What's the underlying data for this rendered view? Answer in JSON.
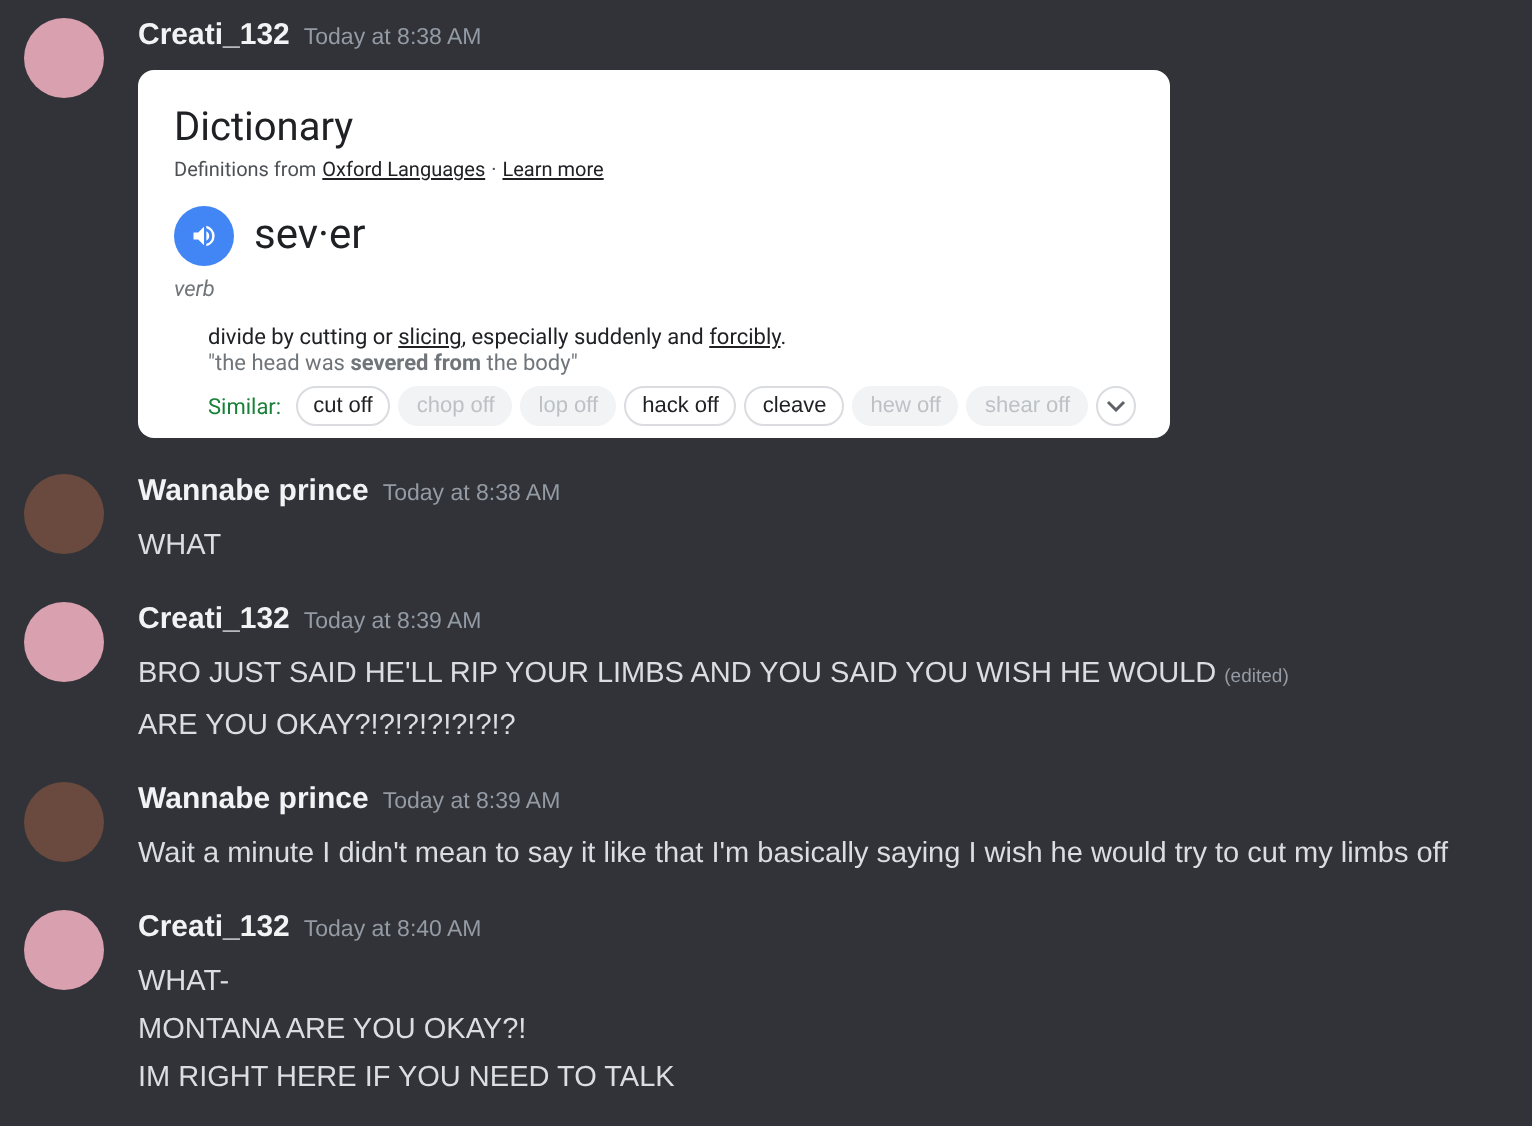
{
  "messages": [
    {
      "author": "Creati_132",
      "time": "Today at 8:38 AM",
      "color": "#d9a0b0",
      "embed": {
        "title": "Dictionary",
        "source_prefix": "Definitions from",
        "source_link": "Oxford Languages",
        "separator": "·",
        "learn_more": "Learn more",
        "word": "sev·er",
        "part_of_speech": "verb",
        "definition": [
          {
            "text": "divide by cutting or ",
            "link": false
          },
          {
            "text": "slicing",
            "link": true
          },
          {
            "text": ", especially suddenly and ",
            "link": false
          },
          {
            "text": "forcibly",
            "link": true
          },
          {
            "text": ".",
            "link": false
          }
        ],
        "example": "\"the head was **severed from** the body\"",
        "similar_label": "Similar:",
        "similar": [
          {
            "label": "cut off",
            "disabled": false
          },
          {
            "label": "chop off",
            "disabled": true
          },
          {
            "label": "lop off",
            "disabled": true
          },
          {
            "label": "hack off",
            "disabled": false
          },
          {
            "label": "cleave",
            "disabled": false
          },
          {
            "label": "hew off",
            "disabled": true
          },
          {
            "label": "shear off",
            "disabled": true
          }
        ]
      }
    },
    {
      "author": "Wannabe prince",
      "time": "Today at 8:38 AM",
      "color": "#6a4a3e",
      "lines": [
        {
          "text": "WHAT"
        }
      ]
    },
    {
      "author": "Creati_132",
      "time": "Today at 8:39 AM",
      "color": "#d9a0b0",
      "lines": [
        {
          "text": "BRO JUST SAID HE'LL RIP YOUR LIMBS AND YOU SAID YOU WISH HE WOULD",
          "edited_label": "(edited)"
        },
        {
          "text": "ARE YOU OKAY?!?!?!?!?!?!?"
        }
      ]
    },
    {
      "author": "Wannabe prince",
      "time": "Today at 8:39 AM",
      "color": "#6a4a3e",
      "lines": [
        {
          "text": "Wait a minute I didn't mean to say it like that I'm basically saying I wish he would try to cut my limbs off"
        }
      ]
    },
    {
      "author": "Creati_132",
      "time": "Today at 8:40 AM",
      "color": "#d9a0b0",
      "lines": [
        {
          "text": "WHAT-"
        },
        {
          "text": "MONTANA ARE YOU OKAY?!"
        },
        {
          "text": "IM RIGHT HERE IF YOU NEED TO TALK"
        }
      ]
    }
  ]
}
